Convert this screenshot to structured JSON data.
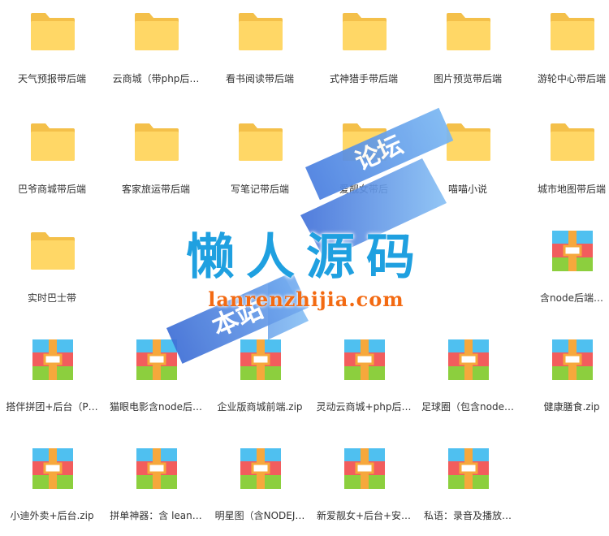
{
  "items": [
    {
      "label": "天气预报带后端",
      "icon": "folder-icon"
    },
    {
      "label": "云商城（带php后…",
      "icon": "folder-icon"
    },
    {
      "label": "看书阅读带后端",
      "icon": "folder-icon"
    },
    {
      "label": "式神猎手带后端",
      "icon": "folder-icon"
    },
    {
      "label": "图片预览带后端",
      "icon": "folder-icon"
    },
    {
      "label": "游轮中心带后端",
      "icon": "folder-icon"
    },
    {
      "label": "巴爷商城带后端",
      "icon": "folder-icon"
    },
    {
      "label": "客家旅运带后端",
      "icon": "folder-icon"
    },
    {
      "label": "写笔记带后端",
      "icon": "folder-icon"
    },
    {
      "label": "爱靓女带后",
      "icon": "folder-icon"
    },
    {
      "label": "喵喵小说",
      "icon": "folder-icon"
    },
    {
      "label": "城市地图带后端",
      "icon": "folder-icon"
    },
    {
      "label": "实时巴士带",
      "icon": "folder-icon"
    },
    {
      "label": "含node后端…",
      "icon": "archive-icon"
    },
    {
      "label": "搭伴拼团+后台（P…",
      "icon": "archive-icon"
    },
    {
      "label": "猫眼电影含node后…",
      "icon": "archive-icon"
    },
    {
      "label": "企业版商城前端.zip",
      "icon": "archive-icon"
    },
    {
      "label": "灵动云商城+php后…",
      "icon": "archive-icon"
    },
    {
      "label": "足球圈（包含node…",
      "icon": "archive-icon"
    },
    {
      "label": "健康膳食.zip",
      "icon": "archive-icon"
    },
    {
      "label": "小迪外卖+后台.zip",
      "icon": "archive-icon"
    },
    {
      "label": "拼单神器：含 lean…",
      "icon": "archive-icon"
    },
    {
      "label": "明星图（含NODEJ…",
      "icon": "archive-icon"
    },
    {
      "label": "新爱靓女+后台+安…",
      "icon": "archive-icon"
    },
    {
      "label": "私语：录音及播放…",
      "icon": "archive-icon"
    }
  ],
  "watermark": {
    "title": "懒人源码",
    "url": "lanrenzhijia.com",
    "banner_top": "论坛",
    "banner_bottom": "本站"
  },
  "colors": {
    "folder_back": "#f4c04a",
    "folder_front": "#ffd766",
    "archive_top": "#4fc0f0",
    "archive_mid": "#f25d5d",
    "archive_bottom": "#8ccf3e",
    "archive_strap": "#f6a83c",
    "title_blue": "#1fa0e0",
    "url_orange": "#f36a12"
  }
}
